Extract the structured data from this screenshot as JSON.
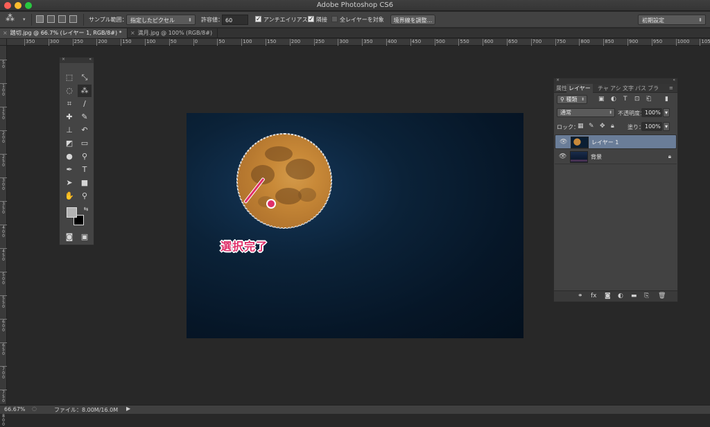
{
  "window": {
    "title": "Adobe Photoshop CS6"
  },
  "options_bar": {
    "tool_icon": "magic-wand-icon",
    "sample_label": "サンプル範囲：",
    "sample_value": "指定したピクセル",
    "tolerance_label": "許容値：",
    "tolerance_value": "60",
    "antialias_label": "アンチエイリアス",
    "antialias_checked": true,
    "contiguous_label": "隣接",
    "contiguous_checked": true,
    "all_layers_label": "全レイヤーを対象",
    "all_layers_checked": false,
    "refine_edge_label": "境界線を調整...",
    "workspace_value": "初期設定"
  },
  "tabs": [
    {
      "label": "踏切.jpg @ 66.7% (レイヤー 1, RGB/8#) *",
      "active": true
    },
    {
      "label": "満月.jpg @ 100% (RGB/8#)",
      "active": false
    }
  ],
  "ruler_top": [
    "350",
    "300",
    "250",
    "200",
    "150",
    "100",
    "50",
    "0",
    "50",
    "100",
    "150",
    "200",
    "250",
    "300",
    "350",
    "400",
    "450",
    "500",
    "550",
    "600",
    "650",
    "700",
    "750",
    "800",
    "850",
    "900",
    "950",
    "1000",
    "1050"
  ],
  "ruler_left": [
    "5\n0",
    "1\n0\n0",
    "1\n5\n0",
    "2\n0\n0",
    "2\n5\n0",
    "3\n0\n0",
    "3\n5\n0",
    "4\n0\n0",
    "4\n5\n0",
    "5\n0\n0",
    "5\n5\n0",
    "6\n0\n0",
    "6\n5\n0",
    "7\n0\n0",
    "7\n5\n0",
    "8\n0\n0"
  ],
  "annotation": {
    "text": "選択完了",
    "color": "#e0306a"
  },
  "layers_panel": {
    "tabs": [
      "属性",
      "レイヤー",
      "チャ",
      "アシ",
      "文字",
      "パス",
      "ブラ"
    ],
    "active_tab": "レイヤー",
    "filter_kind": "種類",
    "blend_mode": "通常",
    "opacity_label": "不透明度：",
    "opacity_value": "100%",
    "lock_label": "ロック：",
    "fill_label": "塗り：",
    "fill_value": "100%",
    "layers": [
      {
        "name": "レイヤー 1",
        "selected": true,
        "locked": false
      },
      {
        "name": "背景",
        "selected": false,
        "locked": true
      }
    ]
  },
  "status_bar": {
    "zoom": "66.67%",
    "file_info": "ファイル：8.00M/16.0M"
  }
}
